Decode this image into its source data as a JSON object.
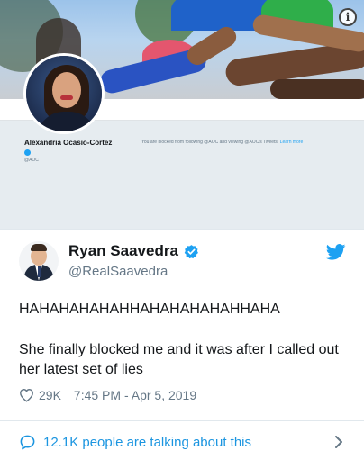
{
  "profile_shot": {
    "name": "Alexandria Ocasio-Cortez",
    "handle": "@AOC",
    "blocked_notice": "You are blocked from following @AOC and viewing @AOC's Tweets.",
    "learn_more": "Learn more",
    "info_icon": "info-icon",
    "colors": {
      "banner_sky": "#9cc3ea",
      "panel": "#e6ecf0",
      "link": "#1da1f2"
    }
  },
  "tweet": {
    "author_name": "Ryan Saavedra",
    "author_handle": "@RealSaavedra",
    "verified": true,
    "text_line1": "HAHAHAHAHAHHAHAHAHAHAHHAHA",
    "text_line2": "She finally blocked me and it was after I called out her latest set of lies",
    "likes": "29K",
    "timestamp": "7:45 PM - Apr 5, 2019",
    "talking": "12.1K people are talking about this",
    "icons": [
      "verified-icon",
      "twitter-bird-icon",
      "heart-icon",
      "comment-bubble-icon",
      "chevron-right-icon"
    ],
    "colors": {
      "brand": "#1da1f2",
      "text": "#14171a",
      "muted": "#657786",
      "link": "#1b95e0"
    }
  }
}
